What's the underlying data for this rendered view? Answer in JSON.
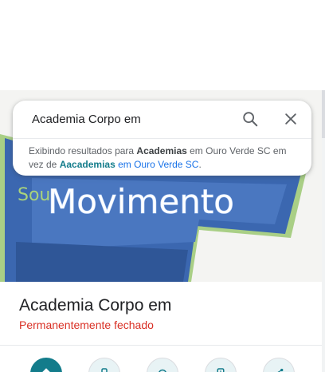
{
  "search": {
    "query": "Academia Corpo em",
    "search_icon": "search-icon",
    "close_icon": "close-icon"
  },
  "notice": {
    "prefix": "Exibindo resultados para ",
    "corrected_term": "Academias",
    "location_1": " em Ouro Verde SC em vez de ",
    "original_term": "Aacademias",
    "location_2": " em Ouro Verde SC",
    "suffix": "."
  },
  "hero": {
    "logo_text": "Movimento",
    "logo_partial_text": "Sou"
  },
  "place": {
    "name": "Academia Corpo em",
    "status": "Permanentemente fechado"
  },
  "actions": [
    {
      "icon": "directions-icon"
    },
    {
      "icon": "phone-icon"
    },
    {
      "icon": "nearby-icon"
    },
    {
      "icon": "send-to-phone-icon"
    },
    {
      "icon": "share-icon"
    }
  ],
  "colors": {
    "accent": "#137c8b",
    "status_closed": "#d93025",
    "link": "#1a73e8"
  }
}
